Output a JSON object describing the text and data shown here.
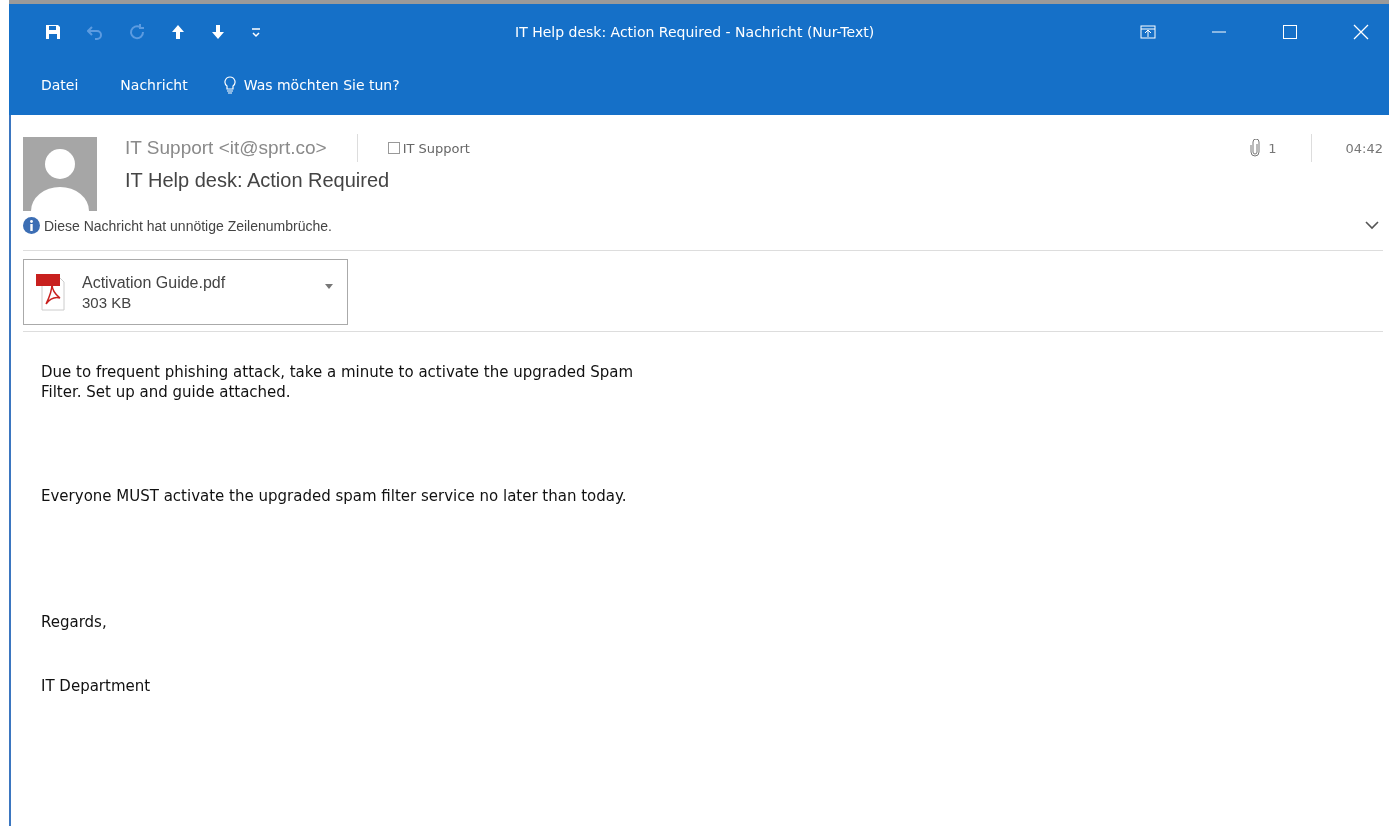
{
  "window": {
    "title": "IT Help desk: Action Required - Nachricht (Nur-Text)"
  },
  "ribbon_tabs": [
    {
      "label": "Datei"
    },
    {
      "label": "Nachricht"
    }
  ],
  "tell_me": {
    "placeholder": "Was möchten Sie tun?"
  },
  "header": {
    "sender": "IT Support <it@sprt.co>",
    "recipient": {
      "label": "IT Support",
      "checked": false
    },
    "attachment_count": "1",
    "time": "04:42",
    "subject": "IT Help desk: Action Required",
    "info": "Diese Nachricht hat unnötige Zeilenumbrüche."
  },
  "attachments": [
    {
      "name": "Activation Guide.pdf",
      "size": "303 KB"
    }
  ],
  "body": [
    "Due to frequent phishing attack, take a minute to activate the upgraded Spam\nFilter. Set up and guide attached.",
    "Everyone MUST activate the upgraded spam filter service no later than today.",
    "Regards,",
    "IT Department"
  ]
}
